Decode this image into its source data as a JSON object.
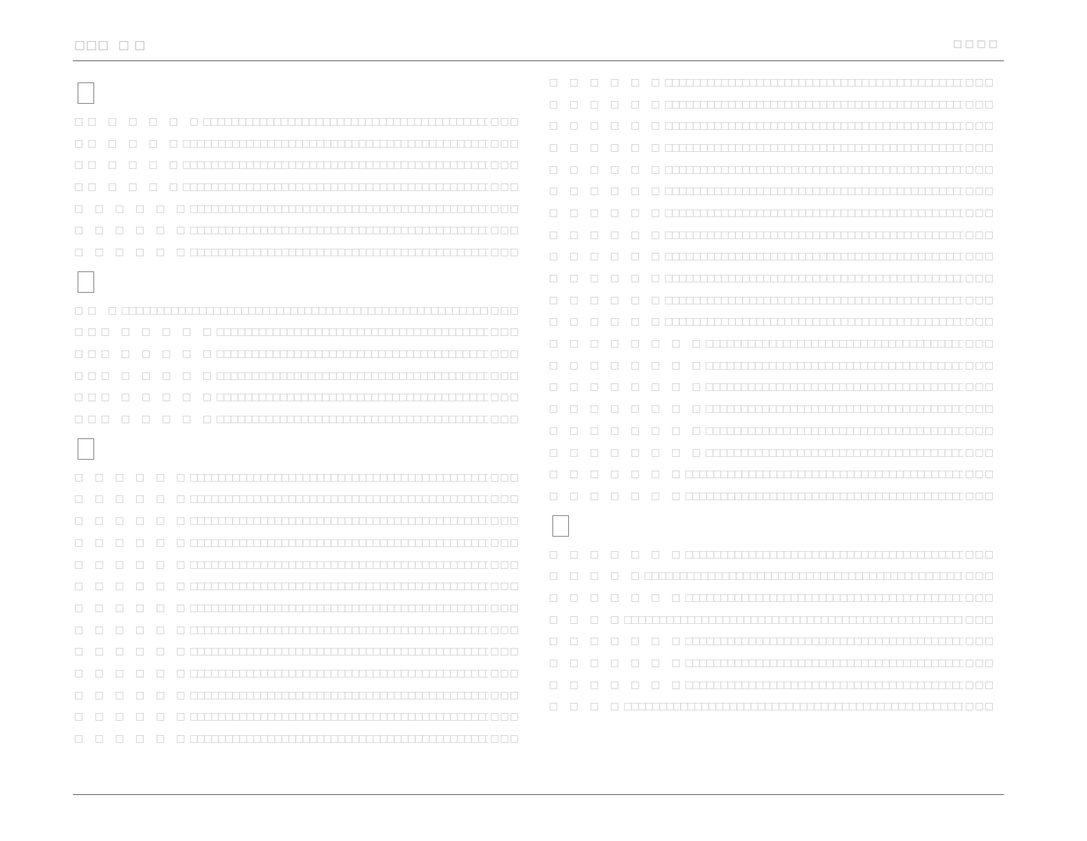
{
  "header": {
    "left_text": "□□□  □ □",
    "right_text": "□□□□"
  },
  "left_column": {
    "sections": [
      {
        "entries": [
          {
            "term": "□□ □ □ □ □ □",
            "desc": "□□□□□□□□□□□□□□□□□□□□□□□□□□□□□□□□□□□□□□□□□□□□□□□□□□□□□□□□□□□□□□□□□□□□□□□□□□□□□□□□□□□□□□□□□□□□□□□□□□□□□□□□□□□□□□□□□□□□□□□□",
            "tail": "□□□"
          },
          {
            "term": "□□ □ □ □ □",
            "desc": "□□□□□□□□□□□□□□□□□□□□□□□□□□□□□□□□□□□□□□□□□□□□□□□□□□□□□□□□□□□□□□□□□□□□□□□□□□□□□□□□□□□□□□□□□□□□□□□□□□□□□□□□□□□□□□□□□□□□□□□□□□□□□□",
            "tail": "□□□"
          },
          {
            "term": "□□ □ □ □ □",
            "desc": "□□□□□□□□□□□□□□□□□□□□□□□□□□□□□□□□□□□□□□□□□□□□□□□□□□□□□□□□□□□□□□□□□□□□□□□□□□□□□□□□□□□□□□□□□□□□□□□□□□□□□□□□□□□□□□□□□□□□□□□□□□□□□□",
            "tail": "□□□"
          },
          {
            "term": "□□ □ □ □ □",
            "desc": "□□□□□□□□□□□□□□□□□□□□□□□□□□□□□□□□□□□□□□□□□□□□□□□□□□□□□□□□□□□□□□□□□□□□□□□□□□□□□□□□□□□□□□□□□□□□□□□□□□□□□□□□□□□□□□□□□□□□□□□□□□□□□□",
            "tail": "□□□"
          },
          {
            "term": "□ □ □ □ □ □",
            "desc": "□□□□□□□□□□□□□□□□□□□□□□□□□□□□□□□□□□□□□□□□□□□□□□□□□□□□□□□□□□□□□□□□□□□□□□□□□□□□□□□□□□□□□□□□□□□□□□□□□□□□□□□□□□□□□□□□□□□□□□□□□□□□□□",
            "tail": "□□□"
          },
          {
            "term": "□ □ □ □ □ □",
            "desc": "□□□□□□□□□□□□□□□□□□□□□□□□□□□□□□□□□□□□□□□□□□□□□□□□□□□□□□□□□□□□□□□□□□□□□□□□□□□□□□□□□□□□□□□□□□□□□□□□□□□□□□□□□□□□□□□□□□□□□□□□□□□□□□",
            "tail": "□□□"
          },
          {
            "term": "□ □ □ □ □ □",
            "desc": "□□□□□□□□□□□□□□□□□□□□□□□□□□□□□□□□□□□□□□□□□□□□□□□□□□□□□□□□□□□□□□□□□□□□□□□□□□□□□□□□□□□□□□□□□□□□□□□□□□□□□□□□□□□□□□□□□□□□□□□□□□□□□□",
            "tail": "□□□"
          }
        ]
      },
      {
        "entries": [
          {
            "term": "□□ □",
            "desc": "□□□□□□□□□□□□□□□□□□□□□□□□□□□□□□□□□□□□□□□□□□□□□□□□□□□□□□□□□□□□□□□□□□□□□□□□□□□□□□□□□□□□□□□□□□□□□□□□□□□□□□□□□□□□□□□□□□□□□□□□□□□□□□□□□□□□□□□□□□",
            "tail": "□□□"
          },
          {
            "term": "□□□ □ □ □ □ □",
            "desc": "□□□□□□□□□□□□□□□□□□□□□□□□□□□□□□□□□□□□□□□□□□□□□□□□□□□□□□□□□□□□□□□□□□□□□□□□□□□□□□□□□□□□□□□□□□□□□□□□□□□□□□□□□□□□□□□□□□□□□□□□",
            "tail": "□□□"
          },
          {
            "term": "□□□ □ □ □ □ □",
            "desc": "□□□□□□□□□□□□□□□□□□□□□□□□□□□□□□□□□□□□□□□□□□□□□□□□□□□□□□□□□□□□□□□□□□□□□□□□□□□□□□□□□□□□□□□□□□□□□□□□□□□□□□□□□□□□□□□□□□□□□□□□",
            "tail": "□□□"
          },
          {
            "term": "□□□ □ □ □ □ □",
            "desc": "□□□□□□□□□□□□□□□□□□□□□□□□□□□□□□□□□□□□□□□□□□□□□□□□□□□□□□□□□□□□□□□□□□□□□□□□□□□□□□□□□□□□□□□□□□□□□□□□□□□□□□□□□□□□□□□□□□□□□□□□",
            "tail": "□□□"
          },
          {
            "term": "□□□ □ □ □ □ □",
            "desc": "□□□□□□□□□□□□□□□□□□□□□□□□□□□□□□□□□□□□□□□□□□□□□□□□□□□□□□□□□□□□□□□□□□□□□□□□□□□□□□□□□□□□□□□□□□□□□□□□□□□□□□□□□□□□□□□□□□□□□□□□",
            "tail": "□□□"
          },
          {
            "term": "□□□ □ □ □ □ □",
            "desc": "□□□□□□□□□□□□□□□□□□□□□□□□□□□□□□□□□□□□□□□□□□□□□□□□□□□□□□□□□□□□□□□□□□□□□□□□□□□□□□□□□□□□□□□□□□□□□□□□□□□□□□□□□□□□□□□□□□□□□□□□",
            "tail": "□□□"
          }
        ]
      },
      {
        "entries": [
          {
            "term": "□ □ □ □ □ □",
            "desc": "□□□□□□□□□□□□□□□□□□□□□□□□□□□□□□□□□□□□□□□□□□□□□□□□□□□□□□□□□□□□□□□□□□□□□□□□□□□□□□□□□□□□□□□□□□□□□□□□□□□□□□□□□□□□□□□□□□□□□□□□□□□□□□",
            "tail": "□□□"
          },
          {
            "term": "□ □ □ □ □ □",
            "desc": "□□□□□□□□□□□□□□□□□□□□□□□□□□□□□□□□□□□□□□□□□□□□□□□□□□□□□□□□□□□□□□□□□□□□□□□□□□□□□□□□□□□□□□□□□□□□□□□□□□□□□□□□□□□□□□□□□□□□□□□□□□□□□□",
            "tail": "□□□"
          },
          {
            "term": "□ □ □ □ □ □",
            "desc": "□□□□□□□□□□□□□□□□□□□□□□□□□□□□□□□□□□□□□□□□□□□□□□□□□□□□□□□□□□□□□□□□□□□□□□□□□□□□□□□□□□□□□□□□□□□□□□□□□□□□□□□□□□□□□□□□□□□□□□□□□□□□□□",
            "tail": "□□□"
          },
          {
            "term": "□ □ □ □ □ □",
            "desc": "□□□□□□□□□□□□□□□□□□□□□□□□□□□□□□□□□□□□□□□□□□□□□□□□□□□□□□□□□□□□□□□□□□□□□□□□□□□□□□□□□□□□□□□□□□□□□□□□□□□□□□□□□□□□□□□□□□□□□□□□□□□□□□",
            "tail": "□□□"
          },
          {
            "term": "□ □ □ □ □ □",
            "desc": "□□□□□□□□□□□□□□□□□□□□□□□□□□□□□□□□□□□□□□□□□□□□□□□□□□□□□□□□□□□□□□□□□□□□□□□□□□□□□□□□□□□□□□□□□□□□□□□□□□□□□□□□□□□□□□□□□□□□□□□□□□□□□□",
            "tail": "□□□"
          },
          {
            "term": "□ □ □ □ □ □",
            "desc": "□□□□□□□□□□□□□□□□□□□□□□□□□□□□□□□□□□□□□□□□□□□□□□□□□□□□□□□□□□□□□□□□□□□□□□□□□□□□□□□□□□□□□□□□□□□□□□□□□□□□□□□□□□□□□□□□□□□□□□□□□□□□□□",
            "tail": "□□□"
          },
          {
            "term": "□ □ □ □ □ □",
            "desc": "□□□□□□□□□□□□□□□□□□□□□□□□□□□□□□□□□□□□□□□□□□□□□□□□□□□□□□□□□□□□□□□□□□□□□□□□□□□□□□□□□□□□□□□□□□□□□□□□□□□□□□□□□□□□□□□□□□□□□□□□□□□□□□",
            "tail": "□□□"
          },
          {
            "term": "□ □ □ □ □ □",
            "desc": "□□□□□□□□□□□□□□□□□□□□□□□□□□□□□□□□□□□□□□□□□□□□□□□□□□□□□□□□□□□□□□□□□□□□□□□□□□□□□□□□□□□□□□□□□□□□□□□□□□□□□□□□□□□□□□□□□□□□□□□□□□□□□□",
            "tail": "□□□"
          },
          {
            "term": "□ □ □ □ □ □",
            "desc": "□□□□□□□□□□□□□□□□□□□□□□□□□□□□□□□□□□□□□□□□□□□□□□□□□□□□□□□□□□□□□□□□□□□□□□□□□□□□□□□□□□□□□□□□□□□□□□□□□□□□□□□□□□□□□□□□□□□□□□□□□□□□□□",
            "tail": "□□□"
          },
          {
            "term": "□ □ □ □ □ □",
            "desc": "□□□□□□□□□□□□□□□□□□□□□□□□□□□□□□□□□□□□□□□□□□□□□□□□□□□□□□□□□□□□□□□□□□□□□□□□□□□□□□□□□□□□□□□□□□□□□□□□□□□□□□□□□□□□□□□□□□□□□□□□□□□□□□",
            "tail": "□□□"
          },
          {
            "term": "□ □ □ □ □ □",
            "desc": "□□□□□□□□□□□□□□□□□□□□□□□□□□□□□□□□□□□□□□□□□□□□□□□□□□□□□□□□□□□□□□□□□□□□□□□□□□□□□□□□□□□□□□□□□□□□□□□□□□□□□□□□□□□□□□□□□□□□□□□□□□□□□□",
            "tail": "□□□"
          },
          {
            "term": "□ □ □ □ □ □",
            "desc": "□□□□□□□□□□□□□□□□□□□□□□□□□□□□□□□□□□□□□□□□□□□□□□□□□□□□□□□□□□□□□□□□□□□□□□□□□□□□□□□□□□□□□□□□□□□□□□□□□□□□□□□□□□□□□□□□□□□□□□□□□□□□□□",
            "tail": "□□□"
          },
          {
            "term": "□ □ □ □ □ □",
            "desc": "□□□□□□□□□□□□□□□□□□□□□□□□□□□□□□□□□□□□□□□□□□□□□□□□□□□□□□□□□□□□□□□□□□□□□□□□□□□□□□□□□□□□□□□□□□□□□□□□□□□□□□□□□□□□□□□□□□□□□□□□□□□□□□",
            "tail": "□□□"
          }
        ]
      }
    ]
  },
  "right_column": {
    "sections": [
      {
        "entries": [
          {
            "term": "□ □ □ □ □ □",
            "desc": "□□□□□□□□□□□□□□□□□□□□□□□□□□□□□□□□□□□□□□□□□□□□□□□□□□□□□□□□□□□□□□□□□□□□□□□□□□□□□□□□□□□□□□□□□□□□□□□□□□□□□□□□□□□□□□□□□□□□□□□□□□□□□□",
            "tail": "□□□"
          },
          {
            "term": "□ □ □ □ □ □",
            "desc": "□□□□□□□□□□□□□□□□□□□□□□□□□□□□□□□□□□□□□□□□□□□□□□□□□□□□□□□□□□□□□□□□□□□□□□□□□□□□□□□□□□□□□□□□□□□□□□□□□□□□□□□□□□□□□□□□□□□□□□□□□□□□□□",
            "tail": "□□□"
          },
          {
            "term": "□ □ □ □ □ □",
            "desc": "□□□□□□□□□□□□□□□□□□□□□□□□□□□□□□□□□□□□□□□□□□□□□□□□□□□□□□□□□□□□□□□□□□□□□□□□□□□□□□□□□□□□□□□□□□□□□□□□□□□□□□□□□□□□□□□□□□□□□□□□□□□□□□",
            "tail": "□□□"
          },
          {
            "term": "□ □ □ □ □ □",
            "desc": "□□□□□□□□□□□□□□□□□□□□□□□□□□□□□□□□□□□□□□□□□□□□□□□□□□□□□□□□□□□□□□□□□□□□□□□□□□□□□□□□□□□□□□□□□□□□□□□□□□□□□□□□□□□□□□□□□□□□□□□□□□□□□□",
            "tail": "□□□"
          },
          {
            "term": "□ □ □ □ □ □",
            "desc": "□□□□□□□□□□□□□□□□□□□□□□□□□□□□□□□□□□□□□□□□□□□□□□□□□□□□□□□□□□□□□□□□□□□□□□□□□□□□□□□□□□□□□□□□□□□□□□□□□□□□□□□□□□□□□□□□□□□□□□□□□□□□□□",
            "tail": "□□□"
          },
          {
            "term": "□ □ □ □ □ □",
            "desc": "□□□□□□□□□□□□□□□□□□□□□□□□□□□□□□□□□□□□□□□□□□□□□□□□□□□□□□□□□□□□□□□□□□□□□□□□□□□□□□□□□□□□□□□□□□□□□□□□□□□□□□□□□□□□□□□□□□□□□□□□□□□□□□",
            "tail": "□□□"
          },
          {
            "term": "□ □ □ □ □ □",
            "desc": "□□□□□□□□□□□□□□□□□□□□□□□□□□□□□□□□□□□□□□□□□□□□□□□□□□□□□□□□□□□□□□□□□□□□□□□□□□□□□□□□□□□□□□□□□□□□□□□□□□□□□□□□□□□□□□□□□□□□□□□□□□□□□□",
            "tail": "□□□"
          },
          {
            "term": "□ □ □ □ □ □",
            "desc": "□□□□□□□□□□□□□□□□□□□□□□□□□□□□□□□□□□□□□□□□□□□□□□□□□□□□□□□□□□□□□□□□□□□□□□□□□□□□□□□□□□□□□□□□□□□□□□□□□□□□□□□□□□□□□□□□□□□□□□□□□□□□□□",
            "tail": "□□□"
          },
          {
            "term": "□ □ □ □ □ □",
            "desc": "□□□□□□□□□□□□□□□□□□□□□□□□□□□□□□□□□□□□□□□□□□□□□□□□□□□□□□□□□□□□□□□□□□□□□□□□□□□□□□□□□□□□□□□□□□□□□□□□□□□□□□□□□□□□□□□□□□□□□□□□□□□□□□",
            "tail": "□□□"
          },
          {
            "term": "□ □ □ □ □ □",
            "desc": "□□□□□□□□□□□□□□□□□□□□□□□□□□□□□□□□□□□□□□□□□□□□□□□□□□□□□□□□□□□□□□□□□□□□□□□□□□□□□□□□□□□□□□□□□□□□□□□□□□□□□□□□□□□□□□□□□□□□□□□□□□□□□□",
            "tail": "□□□"
          },
          {
            "term": "□ □ □ □ □ □",
            "desc": "□□□□□□□□□□□□□□□□□□□□□□□□□□□□□□□□□□□□□□□□□□□□□□□□□□□□□□□□□□□□□□□□□□□□□□□□□□□□□□□□□□□□□□□□□□□□□□□□□□□□□□□□□□□□□□□□□□□□□□□□□□□□□□",
            "tail": "□□□"
          },
          {
            "term": "□ □ □ □ □ □",
            "desc": "□□□□□□□□□□□□□□□□□□□□□□□□□□□□□□□□□□□□□□□□□□□□□□□□□□□□□□□□□□□□□□□□□□□□□□□□□□□□□□□□□□□□□□□□□□□□□□□□□□□□□□□□□□□□□□□□□□□□□□□□□□□□□□",
            "tail": "□□□"
          },
          {
            "term": "□ □ □ □ □ □ □ □",
            "desc": "□□□□□□□□□□□□□□□□□□□□□□□□□□□□□□□□□□□□□□□□□□□□□□□□□□□□□□□□□□□□□□□□□□□□□□□□□□□□□□□□□□□□□□□□□□□□□□□□□□□□□□□□□□□□□□□□□□□",
            "tail": "□□□"
          },
          {
            "term": "□ □ □ □ □ □ □ □",
            "desc": "□□□□□□□□□□□□□□□□□□□□□□□□□□□□□□□□□□□□□□□□□□□□□□□□□□□□□□□□□□□□□□□□□□□□□□□□□□□□□□□□□□□□□□□□□□□□□□□□□□□□□□□□□□□□□□□□□□□",
            "tail": "□□□"
          },
          {
            "term": "□ □ □ □ □ □ □ □",
            "desc": "□□□□□□□□□□□□□□□□□□□□□□□□□□□□□□□□□□□□□□□□□□□□□□□□□□□□□□□□□□□□□□□□□□□□□□□□□□□□□□□□□□□□□□□□□□□□□□□□□□□□□□□□□□□□□□□□□□□",
            "tail": "□□□"
          },
          {
            "term": "□ □ □ □ □ □ □ □",
            "desc": "□□□□□□□□□□□□□□□□□□□□□□□□□□□□□□□□□□□□□□□□□□□□□□□□□□□□□□□□□□□□□□□□□□□□□□□□□□□□□□□□□□□□□□□□□□□□□□□□□□□□□□□□□□□□□□□□□□□",
            "tail": "□□□"
          },
          {
            "term": "□ □ □ □ □ □ □ □",
            "desc": "□□□□□□□□□□□□□□□□□□□□□□□□□□□□□□□□□□□□□□□□□□□□□□□□□□□□□□□□□□□□□□□□□□□□□□□□□□□□□□□□□□□□□□□□□□□□□□□□□□□□□□□□□□□□□□□□□□□",
            "tail": "□□□"
          },
          {
            "term": "□ □ □ □ □ □ □ □",
            "desc": "□□□□□□□□□□□□□□□□□□□□□□□□□□□□□□□□□□□□□□□□□□□□□□□□□□□□□□□□□□□□□□□□□□□□□□□□□□□□□□□□□□□□□□□□□□□□□□□□□□□□□□□□□□□□□□□□□□□",
            "tail": "□□□"
          },
          {
            "term": "□ □ □ □ □ □ □",
            "desc": "□□□□□□□□□□□□□□□□□□□□□□□□□□□□□□□□□□□□□□□□□□□□□□□□□□□□□□□□□□□□□□□□□□□□□□□□□□□□□□□□□□□□□□□□□□□□□□□□□□□□□□□□□□□□□□□□□□□□□□□",
            "tail": "□□□"
          },
          {
            "term": "□ □ □ □ □ □ □",
            "desc": "□□□□□□□□□□□□□□□□□□□□□□□□□□□□□□□□□□□□□□□□□□□□□□□□□□□□□□□□□□□□□□□□□□□□□□□□□□□□□□□□□□□□□□□□□□□□□□□□□□□□□□□□□□□□□□□□□□□□□□□",
            "tail": "□□□"
          }
        ]
      },
      {
        "entries": [
          {
            "term": "□ □ □ □ □ □ □",
            "desc": "□□□□□□□□□□□□□□□□□□□□□□□□□□□□□□□□□□□□□□□□□□□□□□□□□□□□□□□□□□□□□□□□□□□□□□□□□□□□□□□□□□□□□□□□□□□□□□□□□□□□□□□□□□□□□□□□□□□□□□□",
            "tail": "□□□"
          },
          {
            "term": "□ □ □ □ □",
            "desc": "□□□□□□□□□□□□□□□□□□□□□□□□□□□□□□□□□□□□□□□□□□□□□□□□□□□□□□□□□□□□□□□□□□□□□□□□□□□□□□□□□□□□□□□□□□□□□□□□□□□□□□□□□□□□□□□□□□□□□□□□□□□□□□□□",
            "tail": "□□□"
          },
          {
            "term": "□ □ □ □ □ □ □",
            "desc": "□□□□□□□□□□□□□□□□□□□□□□□□□□□□□□□□□□□□□□□□□□□□□□□□□□□□□□□□□□□□□□□□□□□□□□□□□□□□□□□□□□□□□□□□□□□□□□□□□□□□□□□□□□□□□□□□□□□□□□□",
            "tail": "□□□"
          },
          {
            "term": "□ □ □ □",
            "desc": "□□□□□□□□□□□□□□□□□□□□□□□□□□□□□□□□□□□□□□□□□□□□□□□□□□□□□□□□□□□□□□□□□□□□□□□□□□□□□□□□□□□□□□□□□□□□□□□□□□□□□□□□□□□□□□□□□□□□□□□□□□□□□□□□□□□□□",
            "tail": "□□□"
          },
          {
            "term": "□ □ □ □ □ □ □",
            "desc": "□□□□□□□□□□□□□□□□□□□□□□□□□□□□□□□□□□□□□□□□□□□□□□□□□□□□□□□□□□□□□□□□□□□□□□□□□□□□□□□□□□□□□□□□□□□□□□□□□□□□□□□□□□□□□□□□□□□□□□□",
            "tail": "□□□"
          },
          {
            "term": "□ □ □ □ □ □ □",
            "desc": "□□□□□□□□□□□□□□□□□□□□□□□□□□□□□□□□□□□□□□□□□□□□□□□□□□□□□□□□□□□□□□□□□□□□□□□□□□□□□□□□□□□□□□□□□□□□□□□□□□□□□□□□□□□□□□□□□□□□□□□",
            "tail": "□□□"
          },
          {
            "term": "□ □ □ □ □ □ □",
            "desc": "□□□□□□□□□□□□□□□□□□□□□□□□□□□□□□□□□□□□□□□□□□□□□□□□□□□□□□□□□□□□□□□□□□□□□□□□□□□□□□□□□□□□□□□□□□□□□□□□□□□□□□□□□□□□□□□□□□□□□□□",
            "tail": "□□□"
          },
          {
            "term": "□ □ □ □",
            "desc": "□□□□□□□□□□□□□□□□□□□□□□□□□□□□□□□□□□□□□□□□□□□□□□□□□□□□□□□□□□□□□□□□□□□□□□□□□□□□□□□□□□□□□□□□□□□□□□□□□□□□□□□□□□□□□□□□□□□□□□□□□□□□□□□□□□□□□",
            "tail": "□□□"
          }
        ]
      }
    ]
  }
}
